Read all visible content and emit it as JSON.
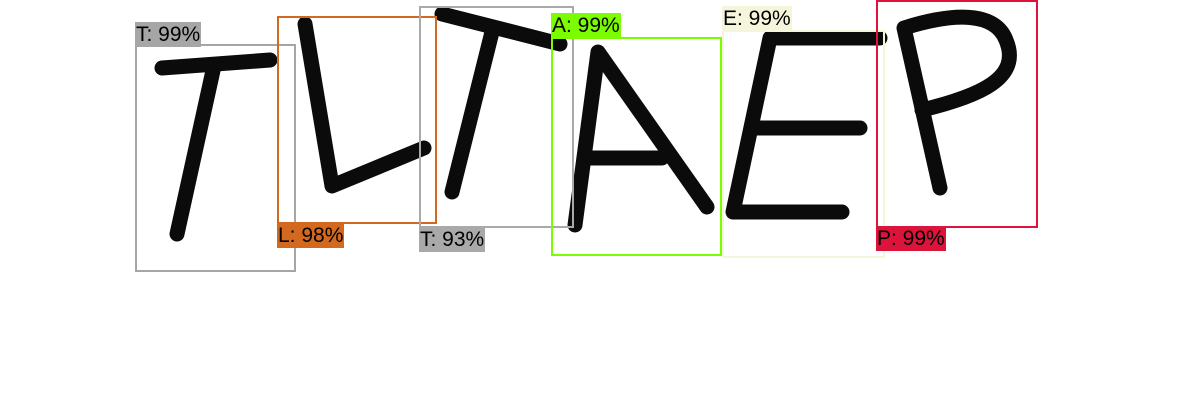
{
  "detections": [
    {
      "label": "T: 99%",
      "color": "#a6a6a6"
    },
    {
      "label": "L: 98%",
      "color": "#d2691e"
    },
    {
      "label": "T: 93%",
      "color": "#a9a9a9"
    },
    {
      "label": "A: 99%",
      "color": "#7cfc00"
    },
    {
      "label": "E: 99%",
      "color": "#f5f5dc"
    },
    {
      "label": "P: 99%",
      "color": "#dc143c"
    }
  ]
}
